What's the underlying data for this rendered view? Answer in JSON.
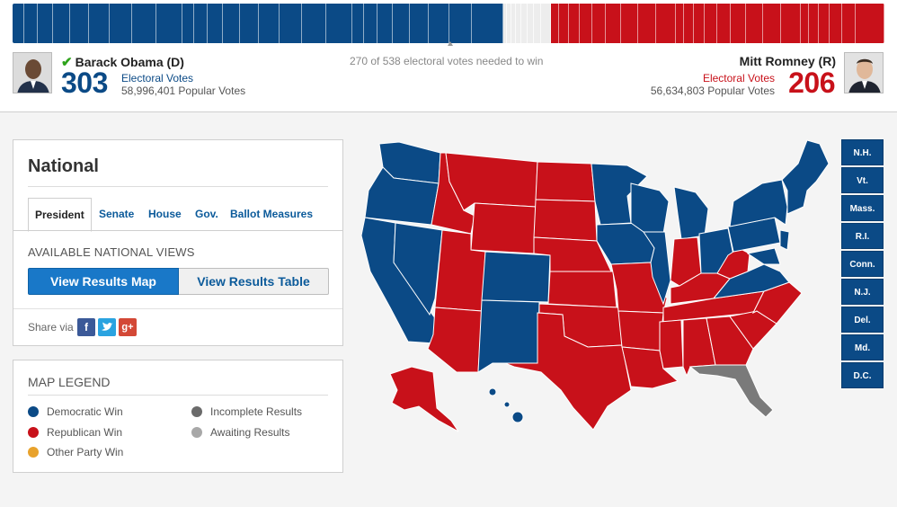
{
  "electoral_bar": {
    "dem_votes": 303,
    "rep_votes": 206,
    "total": 538,
    "colors": {
      "dem": "#0b4a86",
      "rep": "#c8111a",
      "pending": "#ededed"
    }
  },
  "header": {
    "needed_text": "270 of 538 electoral votes needed to win",
    "dem": {
      "name": "Barack Obama (D)",
      "electoral": "303",
      "electoral_label": "Electoral Votes",
      "popular": "58,996,401 Popular Votes",
      "winner_icon": "checkmark-icon"
    },
    "rep": {
      "name": "Mitt Romney (R)",
      "electoral": "206",
      "electoral_label": "Electoral Votes",
      "popular": "56,634,803 Popular Votes"
    }
  },
  "national": {
    "title": "National",
    "tabs": [
      "President",
      "Senate",
      "House",
      "Gov.",
      "Ballot Measures"
    ],
    "active_tab": "President",
    "views_label": "AVAILABLE NATIONAL VIEWS",
    "view_map": "View Results Map",
    "view_table": "View Results Table",
    "share_label": "Share via",
    "share_icons": [
      "facebook-icon",
      "twitter-icon",
      "google-plus-icon"
    ]
  },
  "legend": {
    "title": "MAP LEGEND",
    "items": [
      {
        "label": "Democratic Win",
        "color": "#0b4a86"
      },
      {
        "label": "Republican Win",
        "color": "#c8111a"
      },
      {
        "label": "Other Party Win",
        "color": "#e8a22c"
      },
      {
        "label": "Incomplete Results",
        "color": "#6b6b6b"
      },
      {
        "label": "Awaiting Results",
        "color": "#a8a8a8"
      }
    ]
  },
  "small_states": [
    "N.H.",
    "Vt.",
    "Mass.",
    "R.I.",
    "Conn.",
    "N.J.",
    "Del.",
    "Md.",
    "D.C."
  ]
}
